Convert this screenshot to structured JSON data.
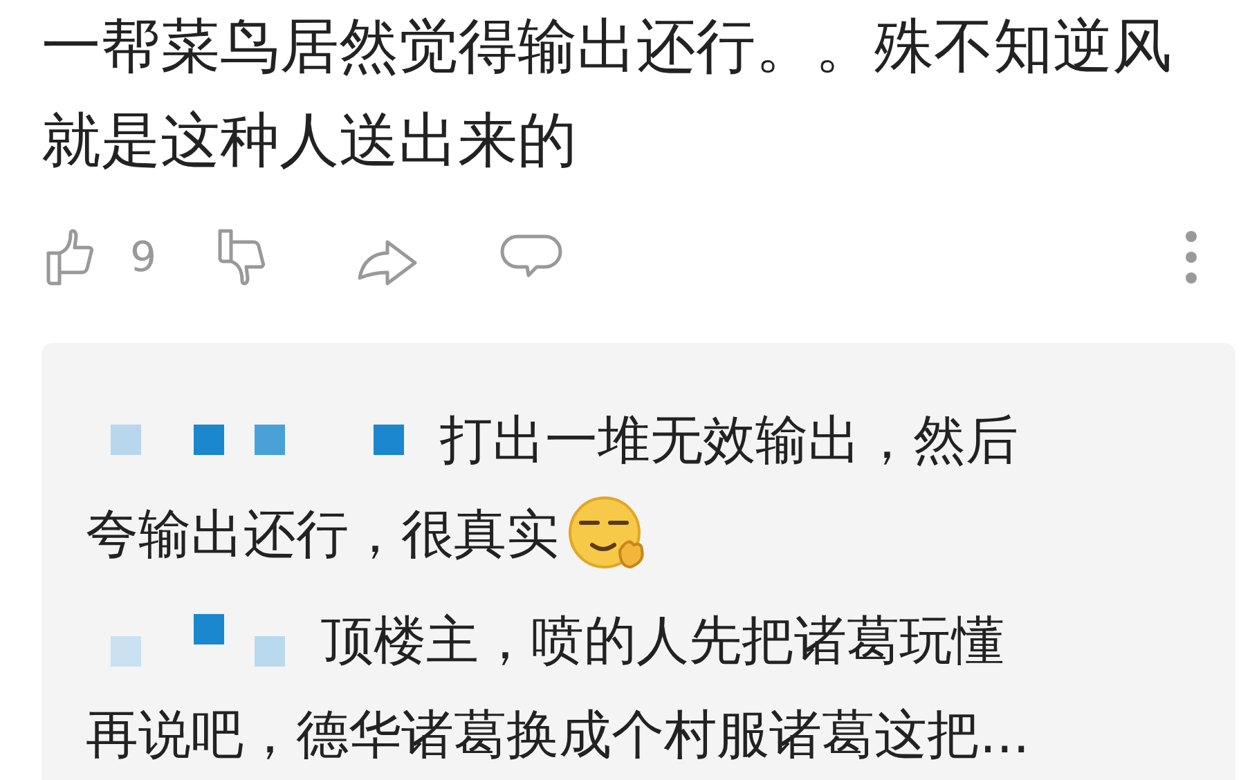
{
  "post": {
    "text": "一帮菜鸟居然觉得输出还行。。殊不知逆风就是这种人送出来的"
  },
  "actions": {
    "like_count": "9"
  },
  "replies": [
    {
      "lines": [
        "打出一堆无效输出，然后",
        "夸输出还行，很真实"
      ],
      "emoji": true
    },
    {
      "lines": [
        "顶楼主，喷的人先把诸葛玩懂",
        "再说吧，德华诸葛换成个村服诸葛这把..."
      ],
      "emoji": false
    }
  ]
}
